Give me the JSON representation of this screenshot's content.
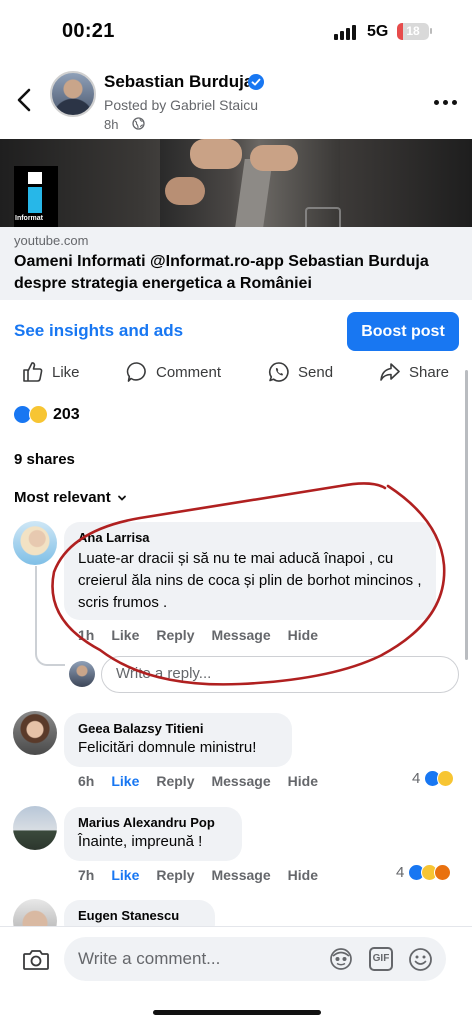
{
  "status_bar": {
    "time": "00:21",
    "network": "5G",
    "battery": "18",
    "battery_level_percent": 18
  },
  "post": {
    "page_name": "Sebastian Burduja",
    "posted_by": "Posted by Gabriel Staicu",
    "time": "8h",
    "image_logo_text": "Informat",
    "link_domain": "youtube.com",
    "link_title": "Oameni Informati @Informat.ro-app Sebastian Burduja despre strategia energetica a României"
  },
  "insights": {
    "link_label": "See insights and ads",
    "boost_label": "Boost post"
  },
  "actions": {
    "like": "Like",
    "comment": "Comment",
    "send": "Send",
    "share": "Share"
  },
  "summary": {
    "reaction_count": "203",
    "shares": "9 shares",
    "sort_label": "Most relevant"
  },
  "comments": [
    {
      "author": "Ana Larrisa",
      "text": "Luate-ar dracii și să nu te mai aducă înapoi , cu creierul ăla nins de coca și plin de borhot mincinos , scris frumos .",
      "time": "1h",
      "like": "Like",
      "reply": "Reply",
      "message": "Message",
      "hide": "Hide"
    },
    {
      "author": "Geea Balazsy Titieni",
      "text": "Felicitări domnule ministru!",
      "time": "6h",
      "like": "Like",
      "reply": "Reply",
      "message": "Message",
      "hide": "Hide",
      "reaction_count": "4"
    },
    {
      "author": "Marius Alexandru Pop",
      "text": "Înainte, impreună !",
      "time": "7h",
      "like": "Like",
      "reply": "Reply",
      "message": "Message",
      "hide": "Hide",
      "reaction_count": "4"
    },
    {
      "author": "Eugen Stanescu"
    }
  ],
  "reply_box": {
    "placeholder": "Write a reply..."
  },
  "composer": {
    "placeholder": "Write a comment...",
    "gif_label": "GIF"
  },
  "colors": {
    "accent": "#1877f2",
    "annotation_red": "#b02020",
    "bubble": "#f0f2f5"
  }
}
